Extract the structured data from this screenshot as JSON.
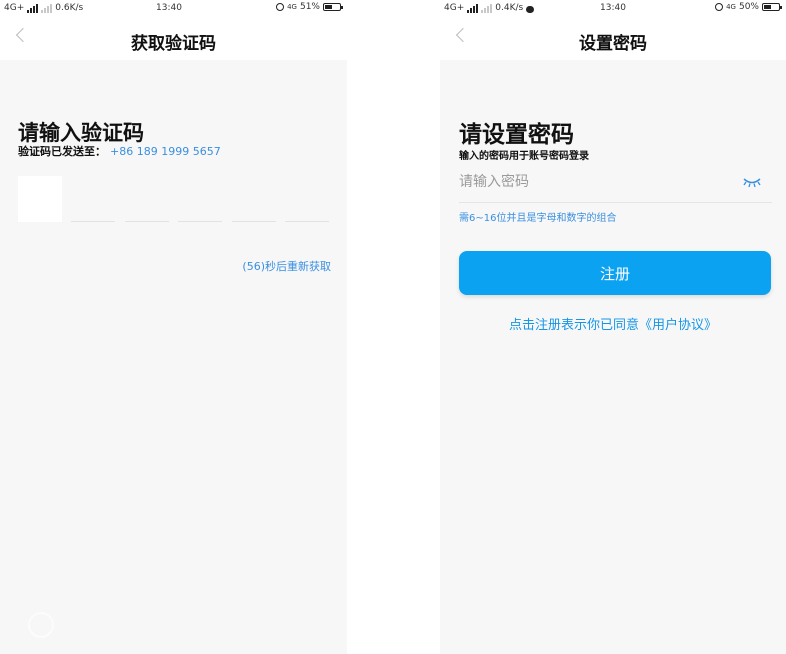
{
  "colors": {
    "accent": "#3a8fe0",
    "button": "#0ba2f2",
    "background": "#f7f7f7"
  },
  "left": {
    "status": {
      "network": "4G+",
      "speed": "0.6K/s",
      "time": "13:40",
      "net_badge": "4G",
      "battery": "51%",
      "battery_level": 0.51
    },
    "nav_title": "获取验证码",
    "heading": "请输入验证码",
    "sent_label": "验证码已发送至：",
    "phone": "+86 189 1999 5657",
    "code_boxes": 6,
    "resend": "(56)秒后重新获取",
    "watermark": "",
    "icons": {
      "back": "chevron-left-icon",
      "alarm": "alarm-icon",
      "signal": "signal-bars-icon",
      "battery": "battery-icon",
      "watermark": "watermark-logo-icon"
    }
  },
  "right": {
    "status": {
      "network": "4G+",
      "speed": "0.4K/s",
      "time": "13:40",
      "net_badge": "4G",
      "battery": "50%",
      "battery_level": 0.5
    },
    "nav_title": "设置密码",
    "heading": "请设置密码",
    "subheading": "输入的密码用于账号密码登录",
    "password_placeholder": "请输入密码",
    "password_value": "",
    "hint": "需6~16位并且是字母和数字的组合",
    "register_label": "注册",
    "agreement": "点击注册表示你已同意《用户协议》",
    "icons": {
      "back": "chevron-left-icon",
      "eye": "eye-closed-icon",
      "chat": "chat-bubble-icon"
    }
  }
}
